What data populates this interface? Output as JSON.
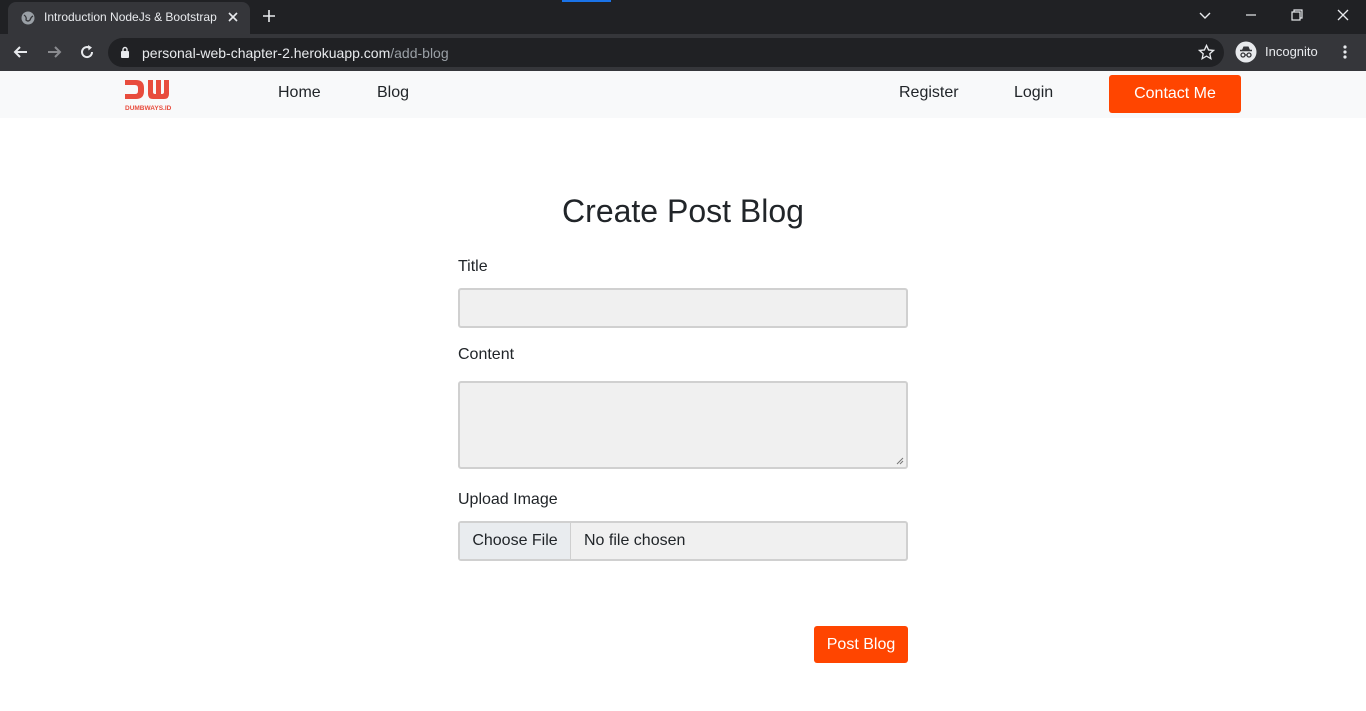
{
  "browser": {
    "tab_title": "Introduction NodeJs & Bootstrap",
    "url_host": "personal-web-chapter-2.herokuapp.com",
    "url_path": "/add-blog",
    "profile_label": "Incognito"
  },
  "navbar": {
    "brand": "DUMBWAYS.ID",
    "links": [
      "Home",
      "Blog",
      "Register",
      "Login"
    ],
    "contact_label": "Contact Me",
    "accent_color": "#ff4500"
  },
  "form": {
    "title": "Create Post Blog",
    "title_label": "Title",
    "content_label": "Content",
    "upload_label": "Upload Image",
    "file_button": "Choose File",
    "file_status": "No file chosen",
    "submit_label": "Post Blog"
  }
}
